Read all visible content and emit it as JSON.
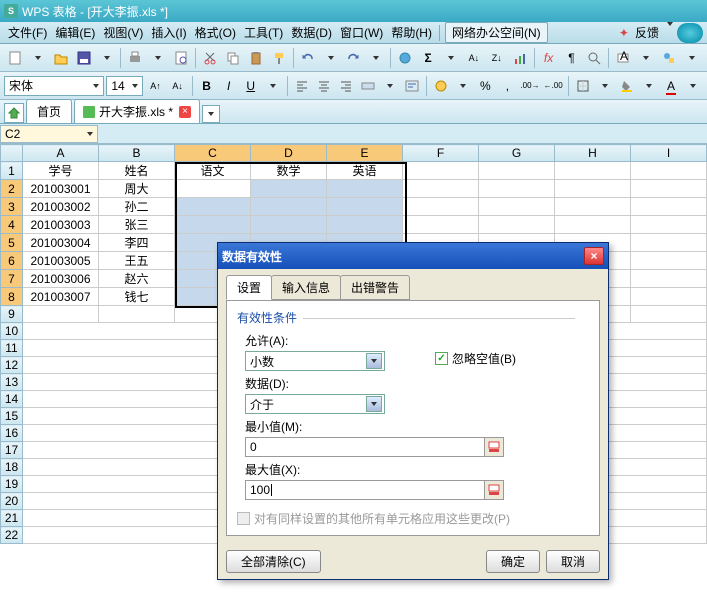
{
  "app": {
    "title": "WPS 表格 - [开大李振.xls *]"
  },
  "menu": {
    "file": "文件(F)",
    "edit": "编辑(E)",
    "view": "视图(V)",
    "insert": "插入(I)",
    "format": "格式(O)",
    "tools": "工具(T)",
    "data": "数据(D)",
    "window": "窗口(W)",
    "help": "帮助(H)",
    "netoffice": "网络办公空间(N)",
    "feedback": "反馈"
  },
  "font": {
    "name": "宋体",
    "size": "14"
  },
  "tabs": {
    "home": "首页",
    "doc": "开大李振.xls *"
  },
  "namebox": "C2",
  "cols": [
    "A",
    "B",
    "C",
    "D",
    "E",
    "F",
    "G",
    "H",
    "I"
  ],
  "rows": [
    "1",
    "2",
    "3",
    "4",
    "5",
    "6",
    "7",
    "8",
    "9",
    "10",
    "11",
    "12",
    "13",
    "14",
    "15",
    "16",
    "17",
    "18",
    "19",
    "20",
    "21",
    "22"
  ],
  "cells": {
    "r1c1": "学号",
    "r1c2": "姓名",
    "r1c3": "语文",
    "r1c4": "数学",
    "r1c5": "英语",
    "r2c1": "201003001",
    "r2c2": "周大",
    "r3c1": "201003002",
    "r3c2": "孙二",
    "r4c1": "201003003",
    "r4c2": "张三",
    "r5c1": "201003004",
    "r5c2": "李四",
    "r6c1": "201003005",
    "r6c2": "王五",
    "r7c1": "201003006",
    "r7c2": "赵六",
    "r8c1": "201003007",
    "r8c2": "钱七"
  },
  "dialog": {
    "title": "数据有效性",
    "tab_settings": "设置",
    "tab_input": "输入信息",
    "tab_error": "出错警告",
    "group": "有效性条件",
    "allow_label": "允许(A):",
    "allow_value": "小数",
    "data_label": "数据(D):",
    "data_value": "介于",
    "min_label": "最小值(M):",
    "min_value": "0",
    "max_label": "最大值(X):",
    "max_value": "100",
    "ignore_blank": "忽略空值(B)",
    "apply_all": "对有同样设置的其他所有单元格应用这些更改(P)",
    "clear_all": "全部清除(C)",
    "ok": "确定",
    "cancel": "取消"
  },
  "colors": {
    "title_bg": "#3ba9c5",
    "sel_orange": "#f9c97a",
    "sel_blue": "#c6d8ec",
    "dlg_title": "#1450b8"
  }
}
